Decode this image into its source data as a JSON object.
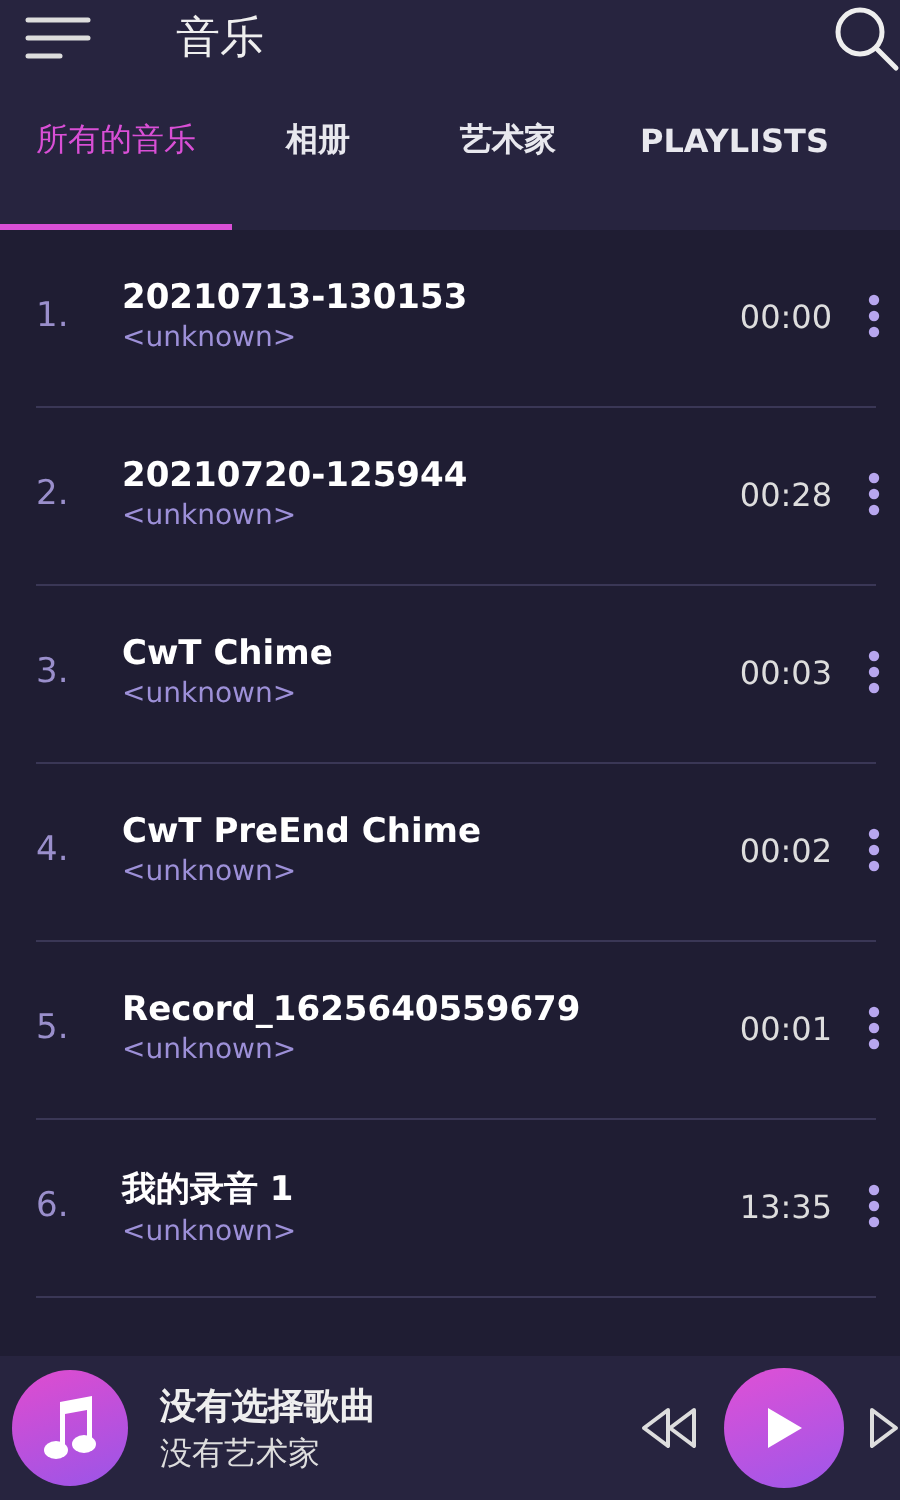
{
  "app_bar": {
    "title": "音乐"
  },
  "tabs": [
    {
      "label": "所有的音乐",
      "selected": true
    },
    {
      "label": "相册",
      "selected": false
    },
    {
      "label": "艺术家",
      "selected": false
    },
    {
      "label": "PLAYLISTS",
      "selected": false
    }
  ],
  "songs": [
    {
      "number": "1.",
      "title": "20210713-130153",
      "artist": "<unknown>",
      "duration": "00:00"
    },
    {
      "number": "2.",
      "title": "20210720-125944",
      "artist": "<unknown>",
      "duration": "00:28"
    },
    {
      "number": "3.",
      "title": "CwT Chime",
      "artist": "<unknown>",
      "duration": "00:03"
    },
    {
      "number": "4.",
      "title": "CwT PreEnd Chime",
      "artist": "<unknown>",
      "duration": "00:02"
    },
    {
      "number": "5.",
      "title": "Record_1625640559679",
      "artist": "<unknown>",
      "duration": "00:01"
    },
    {
      "number": "6.",
      "title": "我的录音 1",
      "artist": "<unknown>",
      "duration": "13:35"
    }
  ],
  "player": {
    "title": "没有选择歌曲",
    "artist": "没有艺术家"
  }
}
